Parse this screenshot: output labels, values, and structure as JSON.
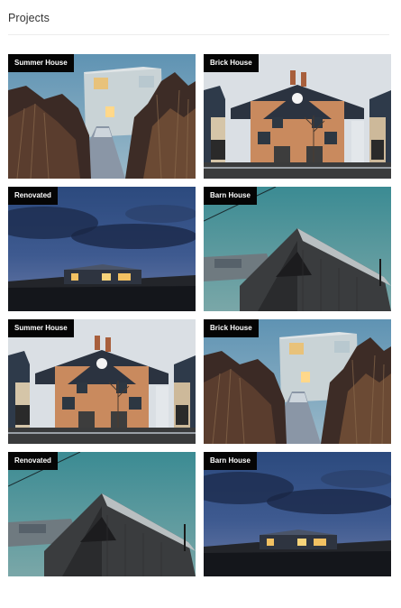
{
  "header": {
    "title": "Projects"
  },
  "projects": [
    {
      "label": "Summer House",
      "scene": "summer-house"
    },
    {
      "label": "Brick House",
      "scene": "brick-house"
    },
    {
      "label": "Renovated",
      "scene": "renovated"
    },
    {
      "label": "Barn House",
      "scene": "barn-house"
    },
    {
      "label": "Summer House",
      "scene": "brick-house"
    },
    {
      "label": "Brick House",
      "scene": "summer-house"
    },
    {
      "label": "Renovated",
      "scene": "barn-house"
    },
    {
      "label": "Barn House",
      "scene": "renovated"
    }
  ]
}
